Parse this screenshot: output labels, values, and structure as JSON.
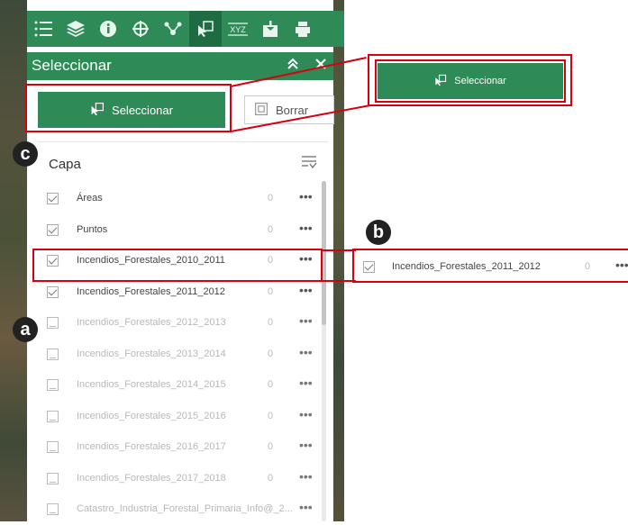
{
  "toolbar": {
    "icons": [
      "layer-list-icon",
      "layers-icon",
      "info-icon",
      "analysis-icon",
      "share-icon",
      "select-icon",
      "xyz-icon",
      "add-data-icon",
      "print-icon"
    ],
    "xyz_label": "XYZ"
  },
  "panel": {
    "title": "Seleccionar",
    "select_button": "Seleccionar",
    "clear_button": "Borrar",
    "layer_header": "Capa",
    "layers": [
      {
        "label": "Áreas",
        "count": "0",
        "checked": true,
        "enabled": true
      },
      {
        "label": "Puntos",
        "count": "0",
        "checked": true,
        "enabled": true
      },
      {
        "label": "Incendios_Forestales_2010_2011",
        "count": "0",
        "checked": true,
        "enabled": true
      },
      {
        "label": "Incendios_Forestales_2011_2012",
        "count": "0",
        "checked": true,
        "enabled": true
      },
      {
        "label": "Incendios_Forestales_2012_2013",
        "count": "0",
        "checked": false,
        "enabled": false
      },
      {
        "label": "Incendios_Forestales_2013_2014",
        "count": "0",
        "checked": false,
        "enabled": false
      },
      {
        "label": "Incendios_Forestales_2014_2015",
        "count": "0",
        "checked": false,
        "enabled": false
      },
      {
        "label": "Incendios_Forestales_2015_2016",
        "count": "0",
        "checked": false,
        "enabled": false
      },
      {
        "label": "Incendios_Forestales_2016_2017",
        "count": "0",
        "checked": false,
        "enabled": false
      },
      {
        "label": "Incendios_Forestales_2017_2018",
        "count": "0",
        "checked": false,
        "enabled": false
      },
      {
        "label": "Catastro_Industria_Forestal_Primaria_Info@_2...",
        "count": "",
        "checked": false,
        "enabled": false
      }
    ],
    "more_label": "•••"
  },
  "callouts": {
    "a": "a",
    "b": "b",
    "c": "c",
    "zoom_select_button": "Seleccionar",
    "zoom_row_label": "Incendios_Forestales_2011_2012",
    "zoom_row_count": "0"
  },
  "colors": {
    "accent": "#2e8b57",
    "highlight": "#d8000f"
  }
}
